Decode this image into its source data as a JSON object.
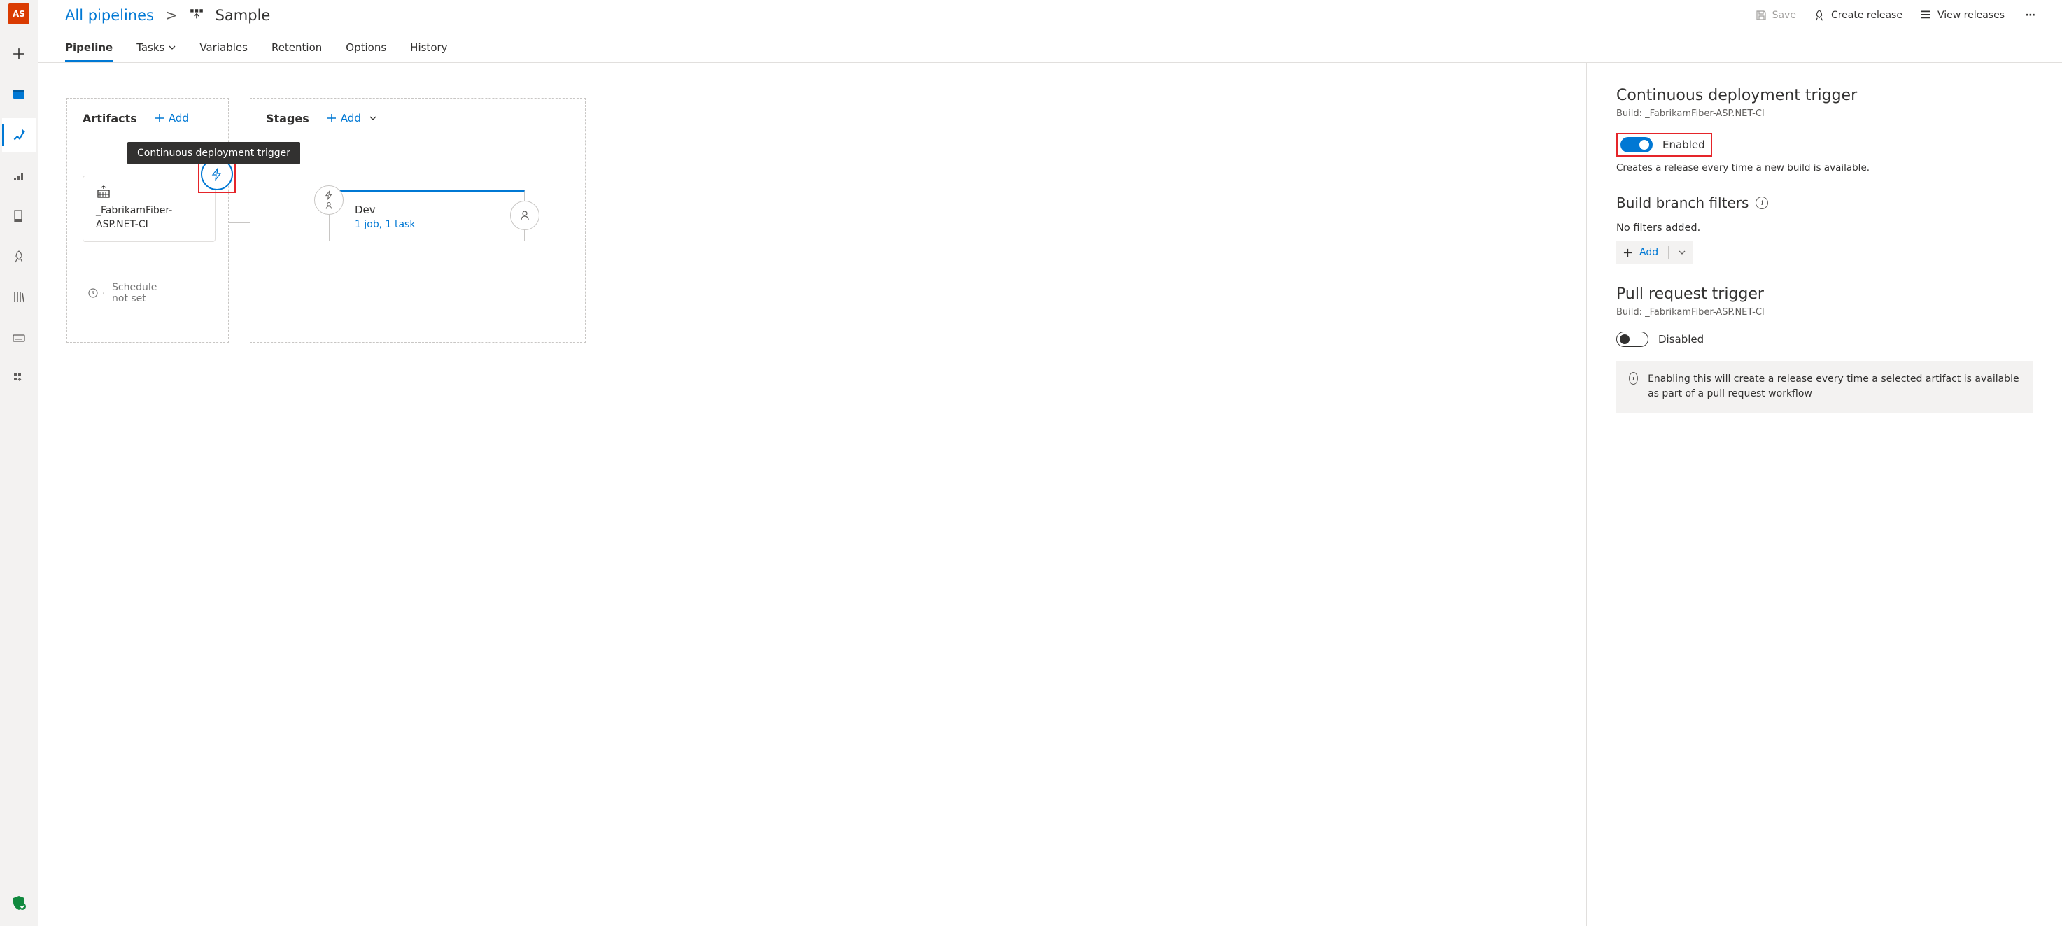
{
  "leftbar": {
    "avatar": "AS"
  },
  "breadcrumbs": {
    "root": "All pipelines",
    "sep": ">",
    "title": "Sample"
  },
  "header_actions": {
    "save": "Save",
    "create_release": "Create release",
    "view_releases": "View releases"
  },
  "tabs": {
    "pipeline": "Pipeline",
    "tasks": "Tasks",
    "variables": "Variables",
    "retention": "Retention",
    "options": "Options",
    "history": "History"
  },
  "artifacts": {
    "heading": "Artifacts",
    "add": "Add",
    "tooltip": "Continuous deployment trigger",
    "card_name": "_FabrikamFiber-ASP.NET-CI",
    "schedule_line1": "Schedule",
    "schedule_line2": "not set"
  },
  "stages": {
    "heading": "Stages",
    "add": "Add",
    "stage1_name": "Dev",
    "stage1_sub": "1 job, 1 task"
  },
  "side": {
    "cd_title": "Continuous deployment trigger",
    "cd_build": "Build: _FabrikamFiber-ASP.NET-CI",
    "enabled_label": "Enabled",
    "enabled_caption": "Creates a release every time a new build is available.",
    "branch_filters_title": "Build branch filters",
    "no_filters": "No filters added.",
    "add_label": "Add",
    "pr_title": "Pull request trigger",
    "pr_build": "Build: _FabrikamFiber-ASP.NET-CI",
    "disabled_label": "Disabled",
    "info": "Enabling this will create a release every time a selected artifact is available as part of a pull request workflow"
  }
}
